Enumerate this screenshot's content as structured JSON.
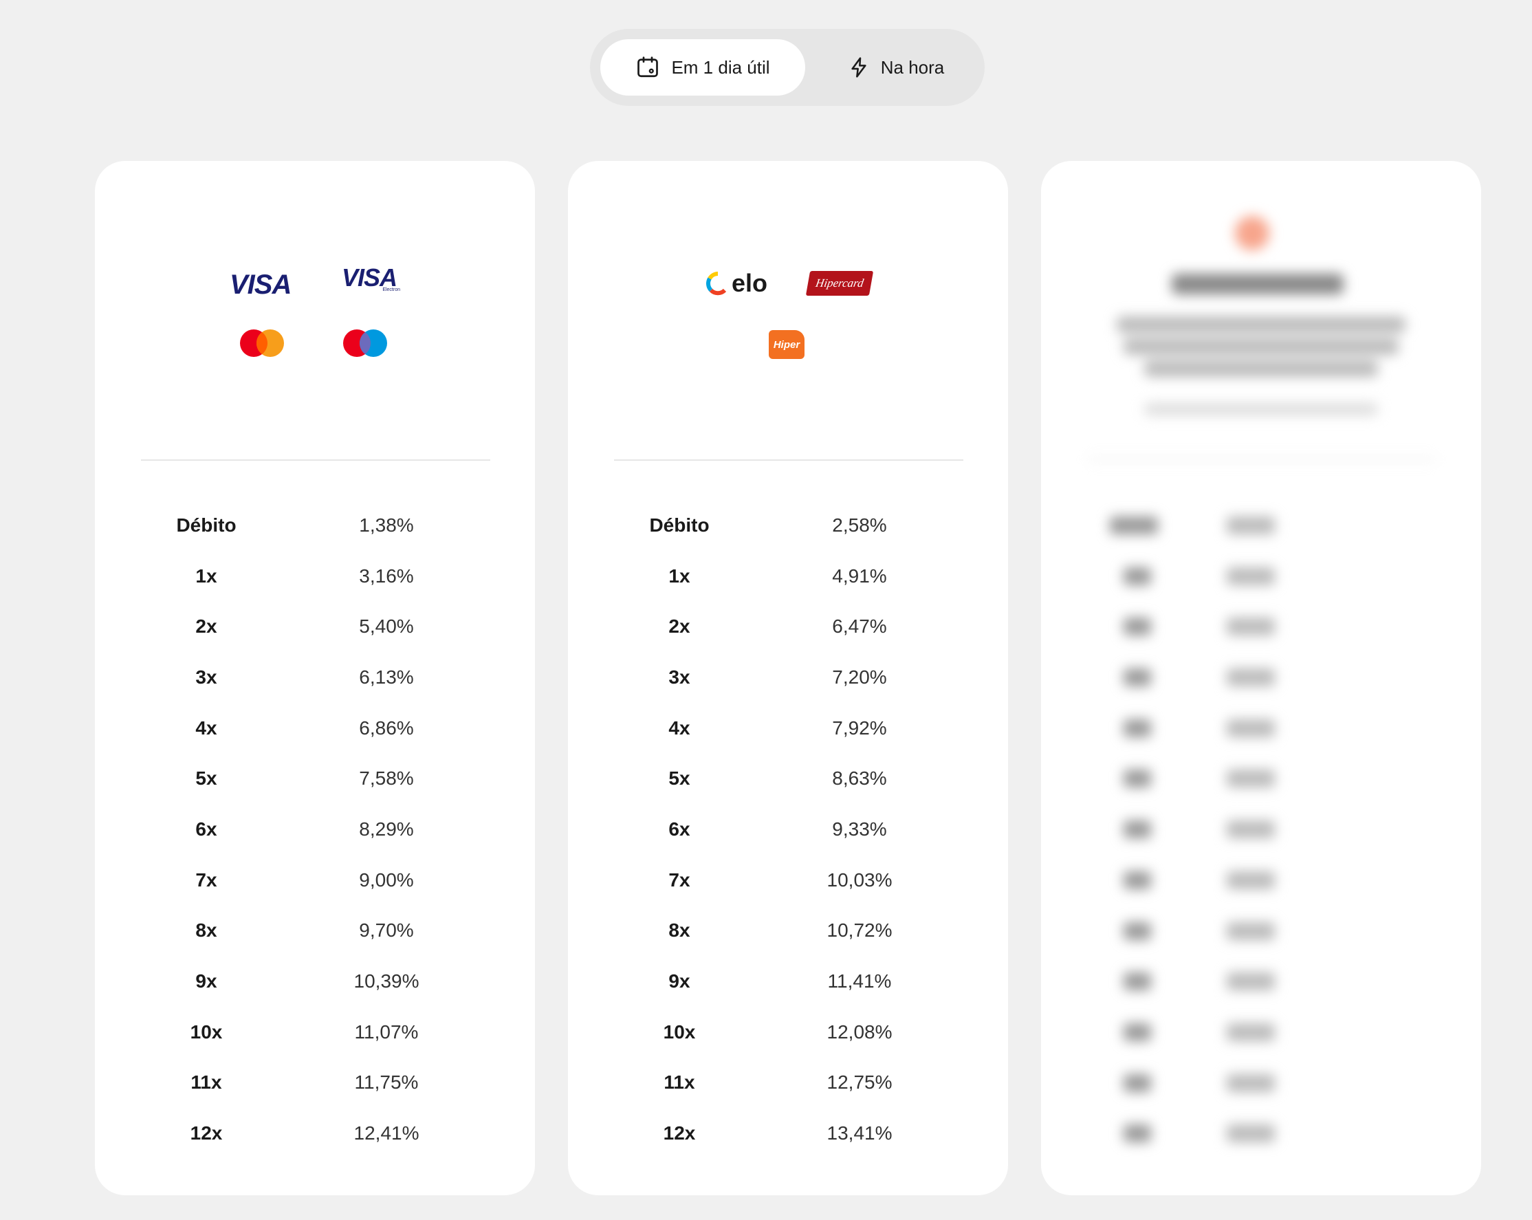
{
  "toggle": {
    "active_label": "Em 1 dia útil",
    "inactive_label": "Na hora"
  },
  "cards": [
    {
      "brands": [
        "VISA",
        "VISA Electron",
        "Mastercard",
        "Maestro"
      ],
      "logo_text": {
        "visa": "VISA",
        "visa_electron": "VISA",
        "visa_electron_sub": "Electron"
      },
      "rates": [
        {
          "label": "Débito",
          "value": "1,38%"
        },
        {
          "label": "1x",
          "value": "3,16%"
        },
        {
          "label": "2x",
          "value": "5,40%"
        },
        {
          "label": "3x",
          "value": "6,13%"
        },
        {
          "label": "4x",
          "value": "6,86%"
        },
        {
          "label": "5x",
          "value": "7,58%"
        },
        {
          "label": "6x",
          "value": "8,29%"
        },
        {
          "label": "7x",
          "value": "9,00%"
        },
        {
          "label": "8x",
          "value": "9,70%"
        },
        {
          "label": "9x",
          "value": "10,39%"
        },
        {
          "label": "10x",
          "value": "11,07%"
        },
        {
          "label": "11x",
          "value": "11,75%"
        },
        {
          "label": "12x",
          "value": "12,41%"
        }
      ]
    },
    {
      "brands": [
        "elo",
        "Hipercard",
        "Hiper"
      ],
      "logo_text": {
        "elo": "elo",
        "hipercard": "Hipercard",
        "hiper": "Hiper"
      },
      "rates": [
        {
          "label": "Débito",
          "value": "2,58%"
        },
        {
          "label": "1x",
          "value": "4,91%"
        },
        {
          "label": "2x",
          "value": "6,47%"
        },
        {
          "label": "3x",
          "value": "7,20%"
        },
        {
          "label": "4x",
          "value": "7,92%"
        },
        {
          "label": "5x",
          "value": "8,63%"
        },
        {
          "label": "6x",
          "value": "9,33%"
        },
        {
          "label": "7x",
          "value": "10,03%"
        },
        {
          "label": "8x",
          "value": "10,72%"
        },
        {
          "label": "9x",
          "value": "11,41%"
        },
        {
          "label": "10x",
          "value": "12,08%"
        },
        {
          "label": "11x",
          "value": "12,75%"
        },
        {
          "label": "12x",
          "value": "13,41%"
        }
      ]
    }
  ],
  "colors": {
    "background": "#f0f0f0",
    "card": "#ffffff",
    "visa_blue": "#1a1f71",
    "mastercard_red": "#eb001b",
    "mastercard_orange": "#f79e1b",
    "maestro_blue": "#0099df",
    "hipercard_red": "#b3131b",
    "hiper_orange": "#f37021"
  },
  "icons": [
    "calendar-icon",
    "lightning-icon"
  ]
}
